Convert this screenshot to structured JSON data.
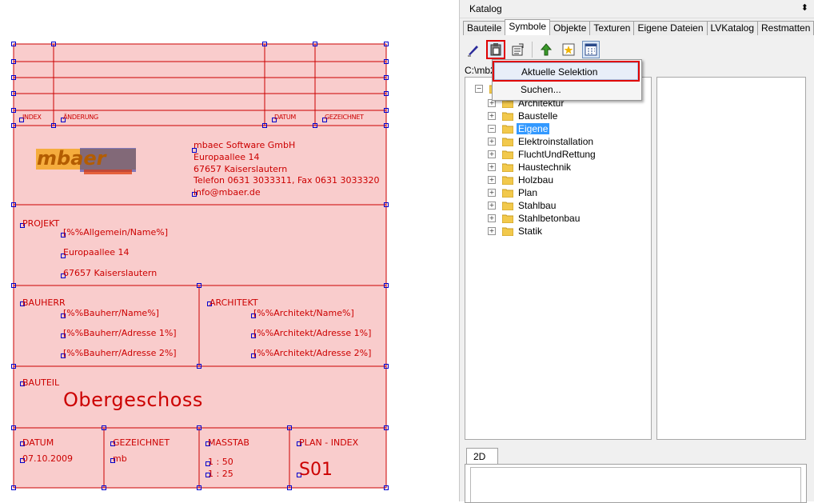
{
  "drawing": {
    "header_cols": {
      "index": "INDEX",
      "change": "ÄNDERUNG",
      "date": "DATUM",
      "drawn": "GEZEICHNET"
    },
    "company": {
      "logo_text": "mbaer",
      "name": "mbaec Software GmbH",
      "street": "Europaallee 14",
      "city": "67657 Kaiserslautern",
      "phone": "Telefon 0631 3033311, Fax 0631 3033320",
      "email": "info@mbaer.de"
    },
    "project": {
      "label": "PROJEKT",
      "name": "[%%Allgemein/Name%]",
      "street": "Europaallee 14",
      "city": "67657 Kaiserslautern"
    },
    "owner": {
      "label": "BAUHERR",
      "name": "[%%Bauherr/Name%]",
      "addr1": "[%%Bauherr/Adresse 1%]",
      "addr2": "[%%Bauherr/Adresse 2%]"
    },
    "architect": {
      "label": "ARCHITEKT",
      "name": "[%%Architekt/Name%]",
      "addr1": "[%%Architekt/Adresse 1%]",
      "addr2": "[%%Architekt/Adresse 2%]"
    },
    "part": {
      "label": "BAUTEIL",
      "value": "Obergeschoss"
    },
    "footer": {
      "date_label": "DATUM",
      "date_value": "07.10.2009",
      "drawn_label": "GEZEICHNET",
      "drawn_value": "mb",
      "scale_label": "MASSTAB",
      "scale_1": "1 : 50",
      "scale_2": "1 : 25",
      "plan_label": "PLAN - INDEX",
      "plan_value": "S01"
    }
  },
  "panel": {
    "title": "Katalog",
    "pin_icon": "pin-icon",
    "tabs": [
      "Bauteile",
      "Symbole",
      "Objekte",
      "Texturen",
      "Eigene Dateien",
      "LVKatalog",
      "Restmatten"
    ],
    "active_tab": "Symbole",
    "path": "C:\\mb2",
    "context_menu": [
      "Aktuelle Selektion",
      "Suchen..."
    ],
    "tree_root": "",
    "tree_items": [
      "Architektur",
      "Baustelle",
      "Eigene",
      "Elektroinstallation",
      "FluchtUndRettung",
      "Haustechnik",
      "Holzbau",
      "Plan",
      "Stahlbau",
      "Stahlbetonbau",
      "Statik"
    ],
    "selected_item": "Eigene",
    "bottom_tab": "2D"
  },
  "colors": {
    "drawing_fill": "#f9cccc",
    "drawing_line": "#cc0000",
    "grip": "#0000cc",
    "selection": "#3399ff",
    "highlight": "#e00000"
  }
}
